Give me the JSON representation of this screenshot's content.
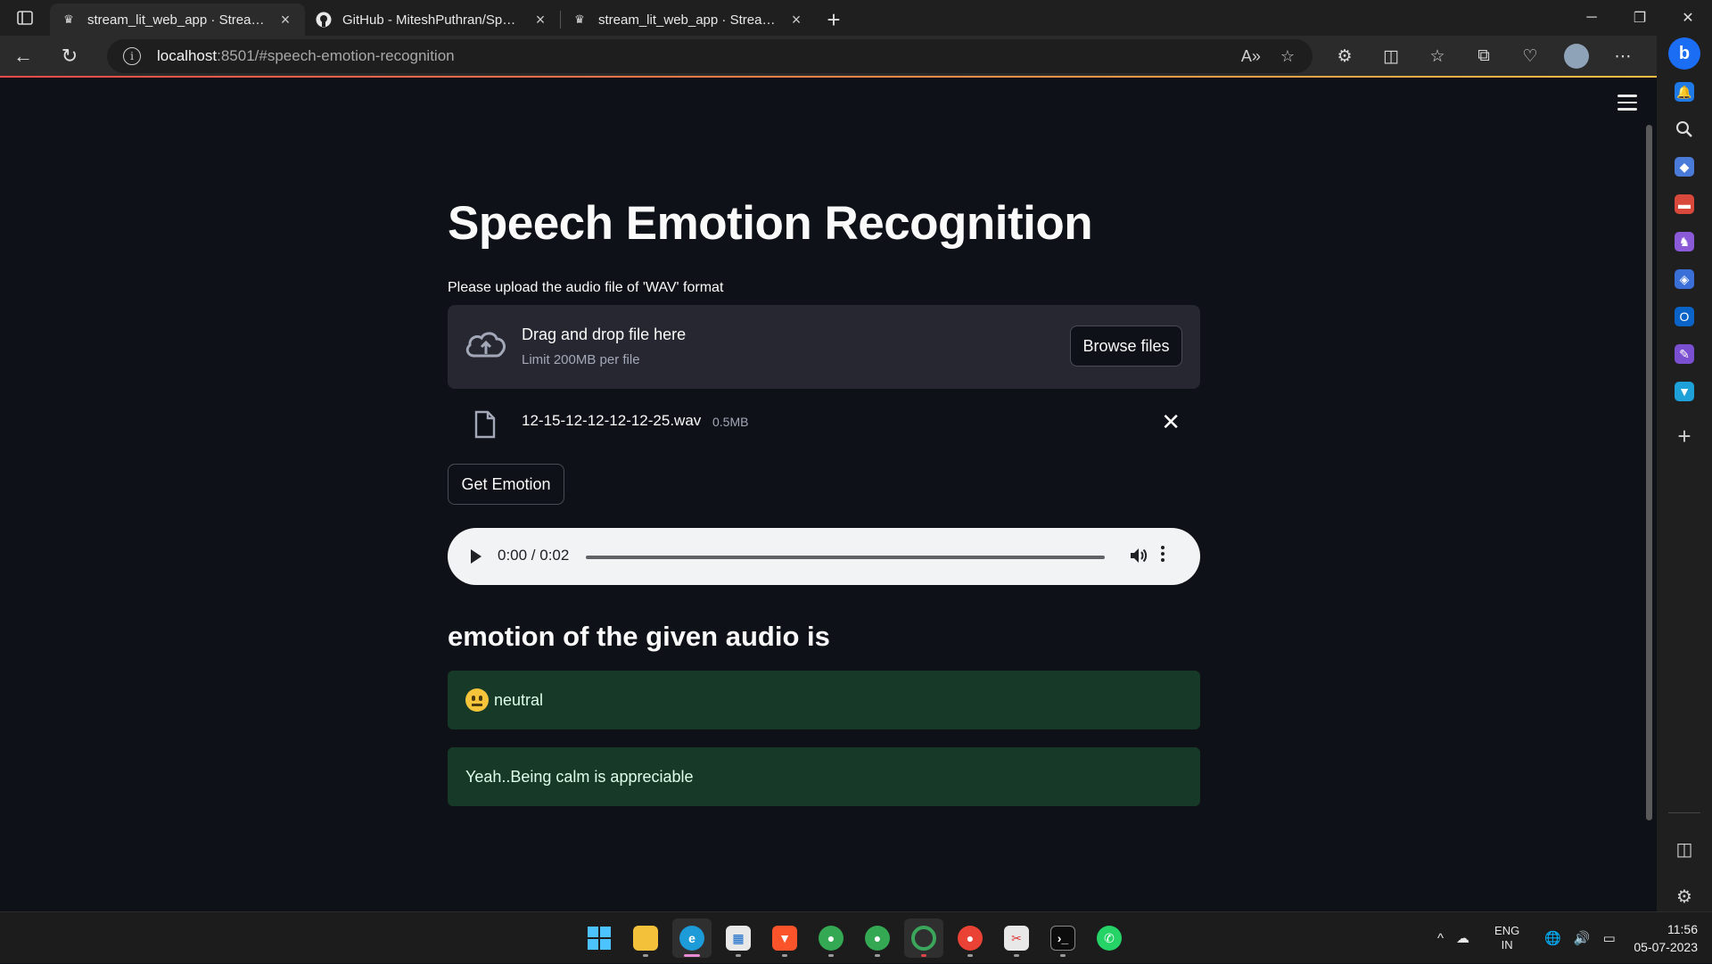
{
  "browser": {
    "tabs": [
      {
        "title": "stream_lit_web_app · Streamlit",
        "favicon": "crown-icon",
        "active": true
      },
      {
        "title": "GitHub - MiteshPuthran/Speech-",
        "favicon": "github-icon",
        "active": false
      },
      {
        "title": "stream_lit_web_app · Streamlit",
        "favicon": "crown-icon",
        "active": false
      }
    ],
    "url_host": "localhost",
    "url_rest": ":8501/#speech-emotion-recognition"
  },
  "app": {
    "title": "Speech Emotion Recognition",
    "upload_label": "Please upload the audio file of 'WAV' format",
    "dropzone_title": "Drag and drop file here",
    "dropzone_limit": "Limit 200MB per file",
    "browse_label": "Browse files",
    "file_name": "12-15-12-12-12-12-25.wav",
    "file_size": "0.5MB",
    "get_emotion_label": "Get Emotion",
    "audio_time": "0:00 / 0:02",
    "result_heading": "emotion of the given audio is",
    "emotion": "neutral",
    "message": "Yeah..Being calm is appreciable"
  },
  "taskbar": {
    "lang_top": "ENG",
    "lang_bottom": "IN",
    "time": "11:56",
    "date": "05-07-2023"
  },
  "colors": {
    "background": "#0e1117",
    "success_bg": "#173928",
    "accent": "#ff4b4b"
  }
}
